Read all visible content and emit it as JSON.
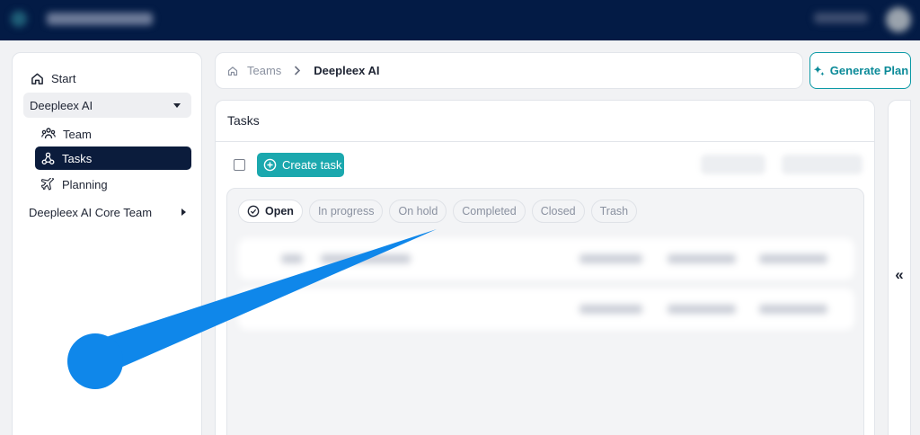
{
  "sidebar": {
    "start_label": "Start",
    "group_label": "Deepleex AI",
    "items": [
      {
        "label": "Team"
      },
      {
        "label": "Tasks"
      },
      {
        "label": "Planning"
      }
    ],
    "group2_label": "Deepleex AI Core Team"
  },
  "breadcrumb": {
    "teams": "Teams",
    "current": "Deepleex AI"
  },
  "header": {
    "generate_label": "Generate Plan"
  },
  "tasks": {
    "title": "Tasks",
    "create_label": "Create task",
    "tabs": [
      {
        "label": "Open"
      },
      {
        "label": "In progress"
      },
      {
        "label": "On hold"
      },
      {
        "label": "Completed"
      },
      {
        "label": "Closed"
      },
      {
        "label": "Trash"
      }
    ]
  },
  "panel": {
    "collapse_label": "«"
  },
  "colors": {
    "topbar": "#031b45",
    "accent": "#1ba8ae",
    "active_nav": "#0b1c3c",
    "pointer": "#0f87ea"
  }
}
